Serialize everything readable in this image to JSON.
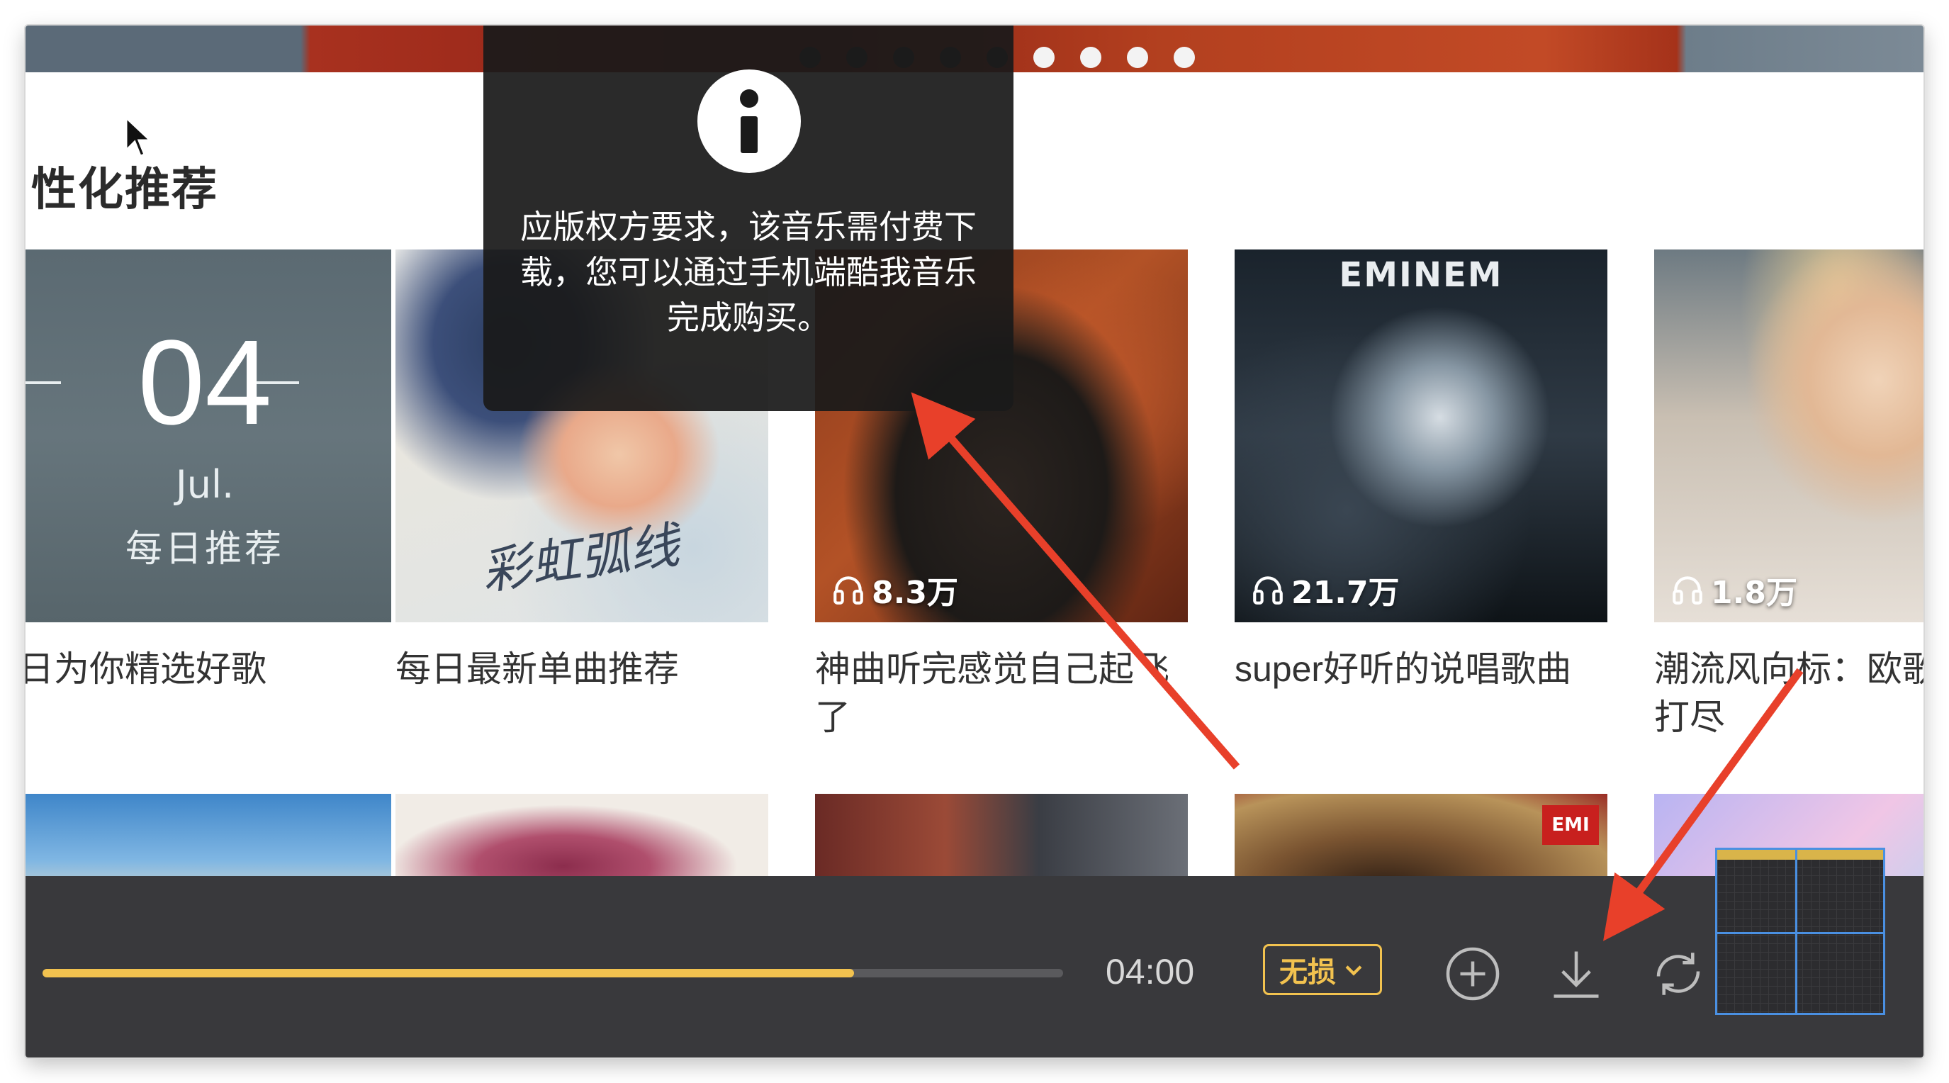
{
  "banner": {
    "dots_total": 9,
    "active_from": 5
  },
  "section": {
    "title": "性化推荐"
  },
  "daily_card": {
    "day": "04",
    "month": "Jul.",
    "label": "每日推荐",
    "caption": "日为你精选好歌"
  },
  "cards": [
    {
      "caption": "每日最新单曲推荐",
      "signature": "彩虹弧线",
      "plays": ""
    },
    {
      "caption": "神曲听完感觉自己起飞了",
      "plays": "8.3万"
    },
    {
      "caption": "super好听的说唱歌曲",
      "plays": "21.7万",
      "logo": "EMINEM"
    },
    {
      "caption": "潮流风向标：欧歌一网打尽",
      "plays": "1.8万"
    }
  ],
  "second_row": {
    "badge": "EMI"
  },
  "tooltip": {
    "icon": "info-icon",
    "message": "应版权方要求，该音乐需付费下载，您可以通过手机端酷我音乐完成购买。"
  },
  "player": {
    "progress": 0.795,
    "time": "04:00",
    "quality_label": "无损",
    "icons": [
      "chevron-down-icon",
      "add-circle-icon",
      "download-icon",
      "loop-icon"
    ]
  },
  "colors": {
    "accent": "#f2c24f",
    "player_bg": "#39393c",
    "annotation": "#e8402a",
    "selection": "#4a90e2"
  }
}
